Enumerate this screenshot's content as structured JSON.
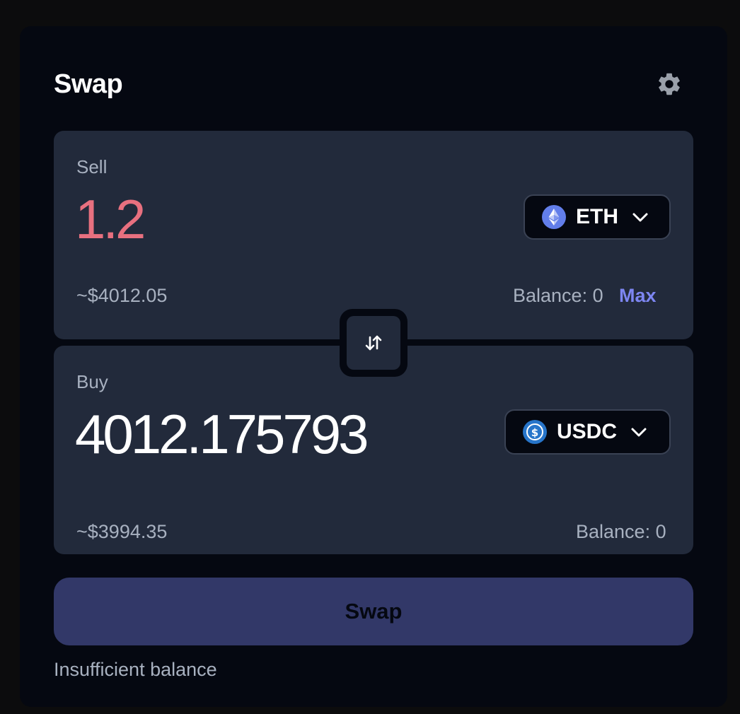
{
  "header": {
    "title": "Swap",
    "settings_icon": "gear-icon"
  },
  "sell": {
    "label": "Sell",
    "amount": "1.2",
    "usd_value": "~$4012.05",
    "balance": "Balance: 0",
    "max_label": "Max",
    "token": {
      "symbol": "ETH",
      "icon": "ethereum-icon"
    }
  },
  "buy": {
    "label": "Buy",
    "amount": "4012.175793",
    "usd_value": "~$3994.35",
    "balance": "Balance: 0",
    "token": {
      "symbol": "USDC",
      "icon": "usdc-icon"
    }
  },
  "flip_icon": "swap-arrows-icon",
  "action": {
    "swap_label": "Swap",
    "error": "Insufficient balance"
  },
  "colors": {
    "sell_amount": "#e8707f",
    "accent": "#7d86f2",
    "panel": "#222a3b",
    "card": "#050811",
    "button": "#323868"
  }
}
